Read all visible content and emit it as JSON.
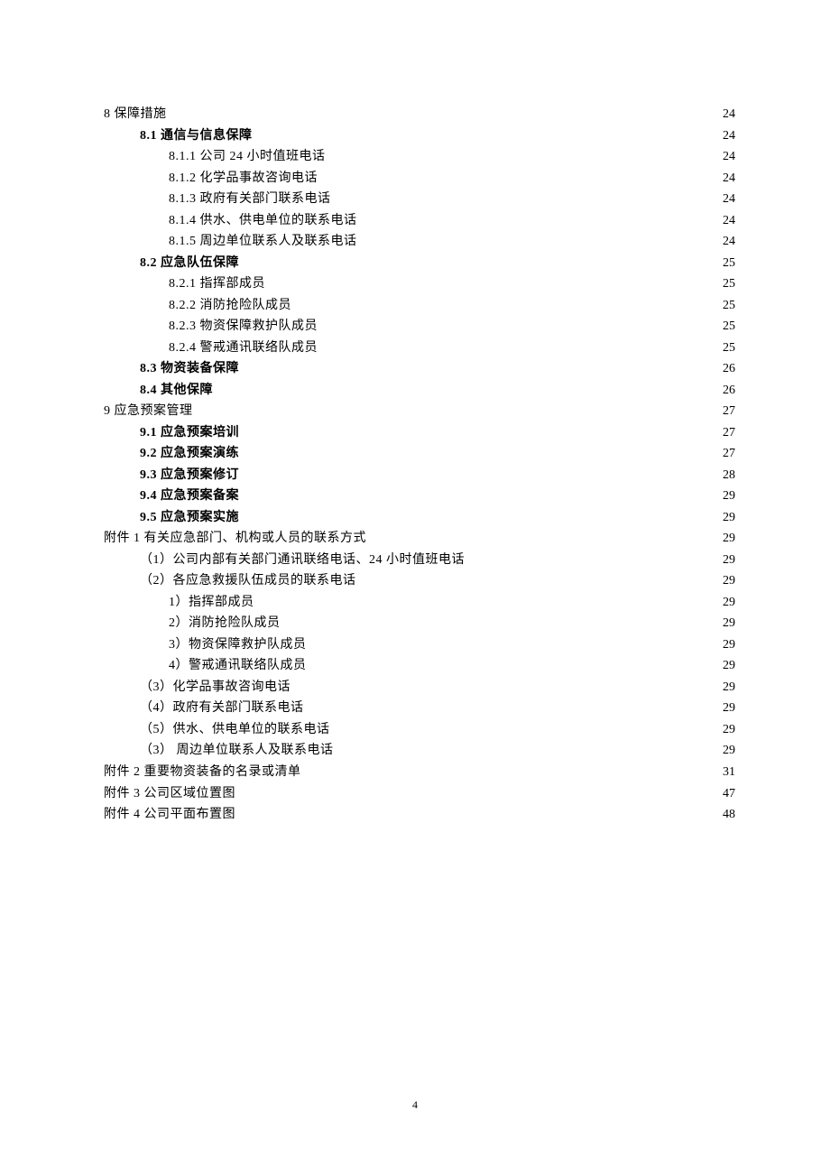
{
  "page_number": "4",
  "toc": [
    {
      "level": 1,
      "title": "8 保障措施",
      "page": "24",
      "bold": false
    },
    {
      "level": 2,
      "title": "8.1 通信与信息保障",
      "page": "24",
      "bold": true
    },
    {
      "level": 3,
      "title": "8.1.1 公司 24 小时值班电话",
      "page": "24",
      "bold": false
    },
    {
      "level": 3,
      "title": "8.1.2 化学品事故咨询电话",
      "page": "24",
      "bold": false
    },
    {
      "level": 3,
      "title": "8.1.3 政府有关部门联系电话",
      "page": "24",
      "bold": false
    },
    {
      "level": 3,
      "title": "8.1.4 供水、供电单位的联系电话",
      "page": "24",
      "bold": false
    },
    {
      "level": 3,
      "title": "8.1.5 周边单位联系人及联系电话",
      "page": "24",
      "bold": false
    },
    {
      "level": 2,
      "title": "8.2 应急队伍保障",
      "page": "25",
      "bold": true
    },
    {
      "level": 3,
      "title": "8.2.1 指挥部成员",
      "page": "25",
      "bold": false
    },
    {
      "level": 3,
      "title": "8.2.2 消防抢险队成员",
      "page": "25",
      "bold": false
    },
    {
      "level": 3,
      "title": "8.2.3 物资保障救护队成员",
      "page": "25",
      "bold": false
    },
    {
      "level": 3,
      "title": "8.2.4 警戒通讯联络队成员",
      "page": "25",
      "bold": false
    },
    {
      "level": 2,
      "title": "8.3  物资装备保障",
      "page": "26",
      "bold": true
    },
    {
      "level": 2,
      "title": "8.4 其他保障",
      "page": "26",
      "bold": true
    },
    {
      "level": 1,
      "title": "9 应急预案管理",
      "page": "27",
      "bold": false
    },
    {
      "level": 2,
      "title": "9.1 应急预案培训",
      "page": "27",
      "bold": true
    },
    {
      "level": 2,
      "title": "9.2 应急预案演练",
      "page": "27",
      "bold": true
    },
    {
      "level": 2,
      "title": "9.3 应急预案修订",
      "page": "28",
      "bold": true
    },
    {
      "level": 2,
      "title": "9.4 应急预案备案",
      "page": "29",
      "bold": true
    },
    {
      "level": 2,
      "title": "9.5 应急预案实施",
      "page": "29",
      "bold": true
    },
    {
      "level": 1,
      "title": "附件 1 有关应急部门、机构或人员的联系方式",
      "page": "29",
      "bold": false
    },
    {
      "level": 2,
      "title": "（1）公司内部有关部门通讯联络电话、24 小时值班电话",
      "page": "29",
      "bold": false
    },
    {
      "level": 2,
      "title": "（2）各应急救援队伍成员的联系电话",
      "page": "29",
      "bold": false
    },
    {
      "level": 3,
      "title": "1）指挥部成员",
      "page": "29",
      "bold": false
    },
    {
      "level": 3,
      "title": "2）消防抢险队成员",
      "page": "29",
      "bold": false
    },
    {
      "level": 3,
      "title": "3）物资保障救护队成员",
      "page": "29",
      "bold": false
    },
    {
      "level": 3,
      "title": "4）警戒通讯联络队成员",
      "page": "29",
      "bold": false
    },
    {
      "level": 2,
      "title": "（3）化学品事故咨询电话",
      "page": "29",
      "bold": false
    },
    {
      "level": 2,
      "title": "（4）政府有关部门联系电话",
      "page": "29",
      "bold": false
    },
    {
      "level": 2,
      "title": "（5）供水、供电单位的联系电话",
      "page": "29",
      "bold": false
    },
    {
      "level": 2,
      "title": "（3） 周边单位联系人及联系电话",
      "page": "29",
      "bold": false
    },
    {
      "level": 1,
      "title": "附件 2 重要物资装备的名录或清单",
      "page": "31",
      "bold": false
    },
    {
      "level": 1,
      "title": "附件 3 公司区域位置图",
      "page": "47",
      "bold": false
    },
    {
      "level": 1,
      "title": "附件 4 公司平面布置图",
      "page": "48",
      "bold": false
    }
  ]
}
